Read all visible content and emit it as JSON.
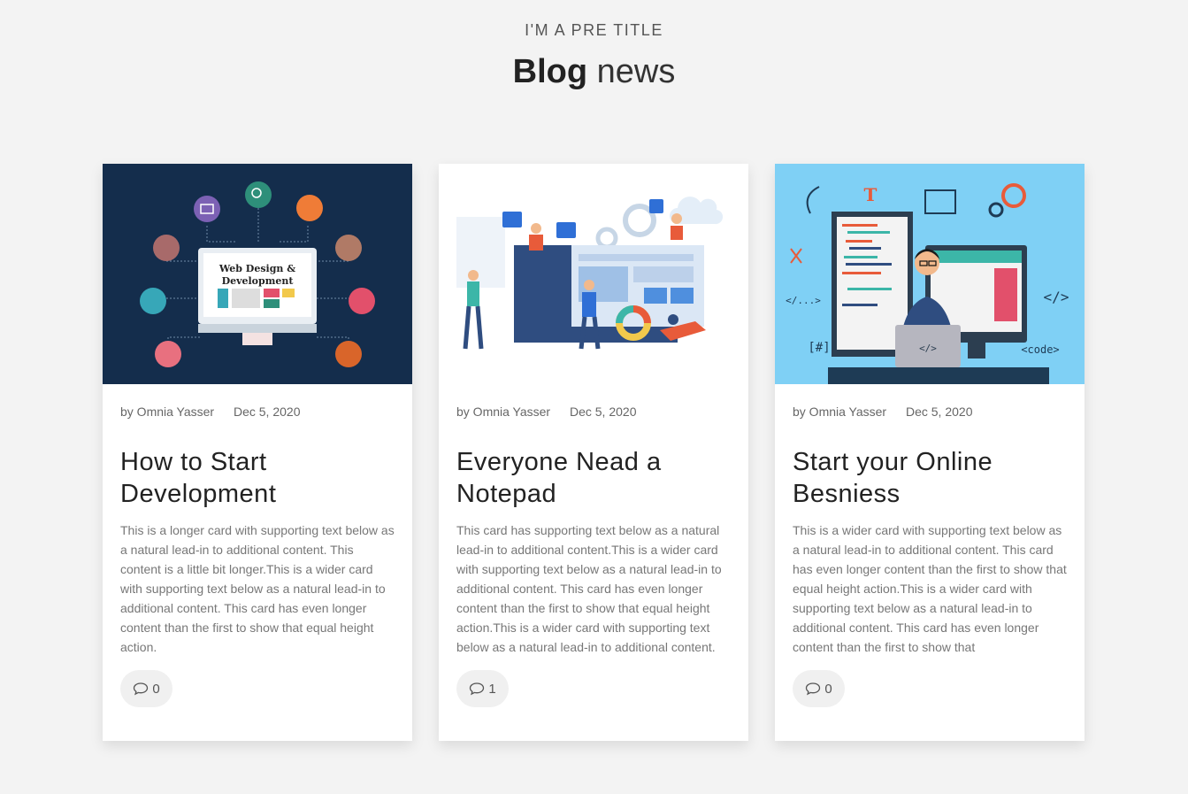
{
  "header": {
    "pre_title": "I'M A PRE TITLE",
    "title_strong": "Blog",
    "title_light": "news"
  },
  "posts": [
    {
      "image": "web-design-development-illustration",
      "image_caption_line1": "Web Design &",
      "image_caption_line2": "Development",
      "author": "by Omnia Yasser",
      "date": "Dec 5, 2020",
      "title": "How to Start Development",
      "body": "This is a longer card with supporting text below as a natural lead-in to additional content. This content is a little bit longer.This is a wider card with supporting text below as a natural lead-in to additional content. This card has even longer content than the first to show that equal height action.",
      "comments": "0"
    },
    {
      "image": "team-coding-illustration",
      "author": "by Omnia Yasser",
      "date": "Dec 5, 2020",
      "title": "Everyone Nead a Notepad",
      "body": "This card has supporting text below as a natural lead-in to additional content.This is a wider card with supporting text below as a natural lead-in to additional content. This card has even longer content than the first to show that equal height action.This is a wider card with supporting text below as a natural lead-in to additional content.",
      "comments": "1"
    },
    {
      "image": "developer-at-laptop-illustration",
      "image_code_label": "<code>",
      "author": "by Omnia Yasser",
      "date": "Dec 5, 2020",
      "title": "Start your Online Besniess",
      "body": "This is a wider card with supporting text below as a natural lead-in to additional content. This card has even longer content than the first to show that equal height action.This is a wider card with supporting text below as a natural lead-in to additional content. This card has even longer content than the first to show that",
      "comments": "0"
    }
  ],
  "colors": {
    "background": "#f3f3f3",
    "card_1_image_bg": "#142d4c",
    "card_3_image_bg": "#7fd0f5"
  }
}
